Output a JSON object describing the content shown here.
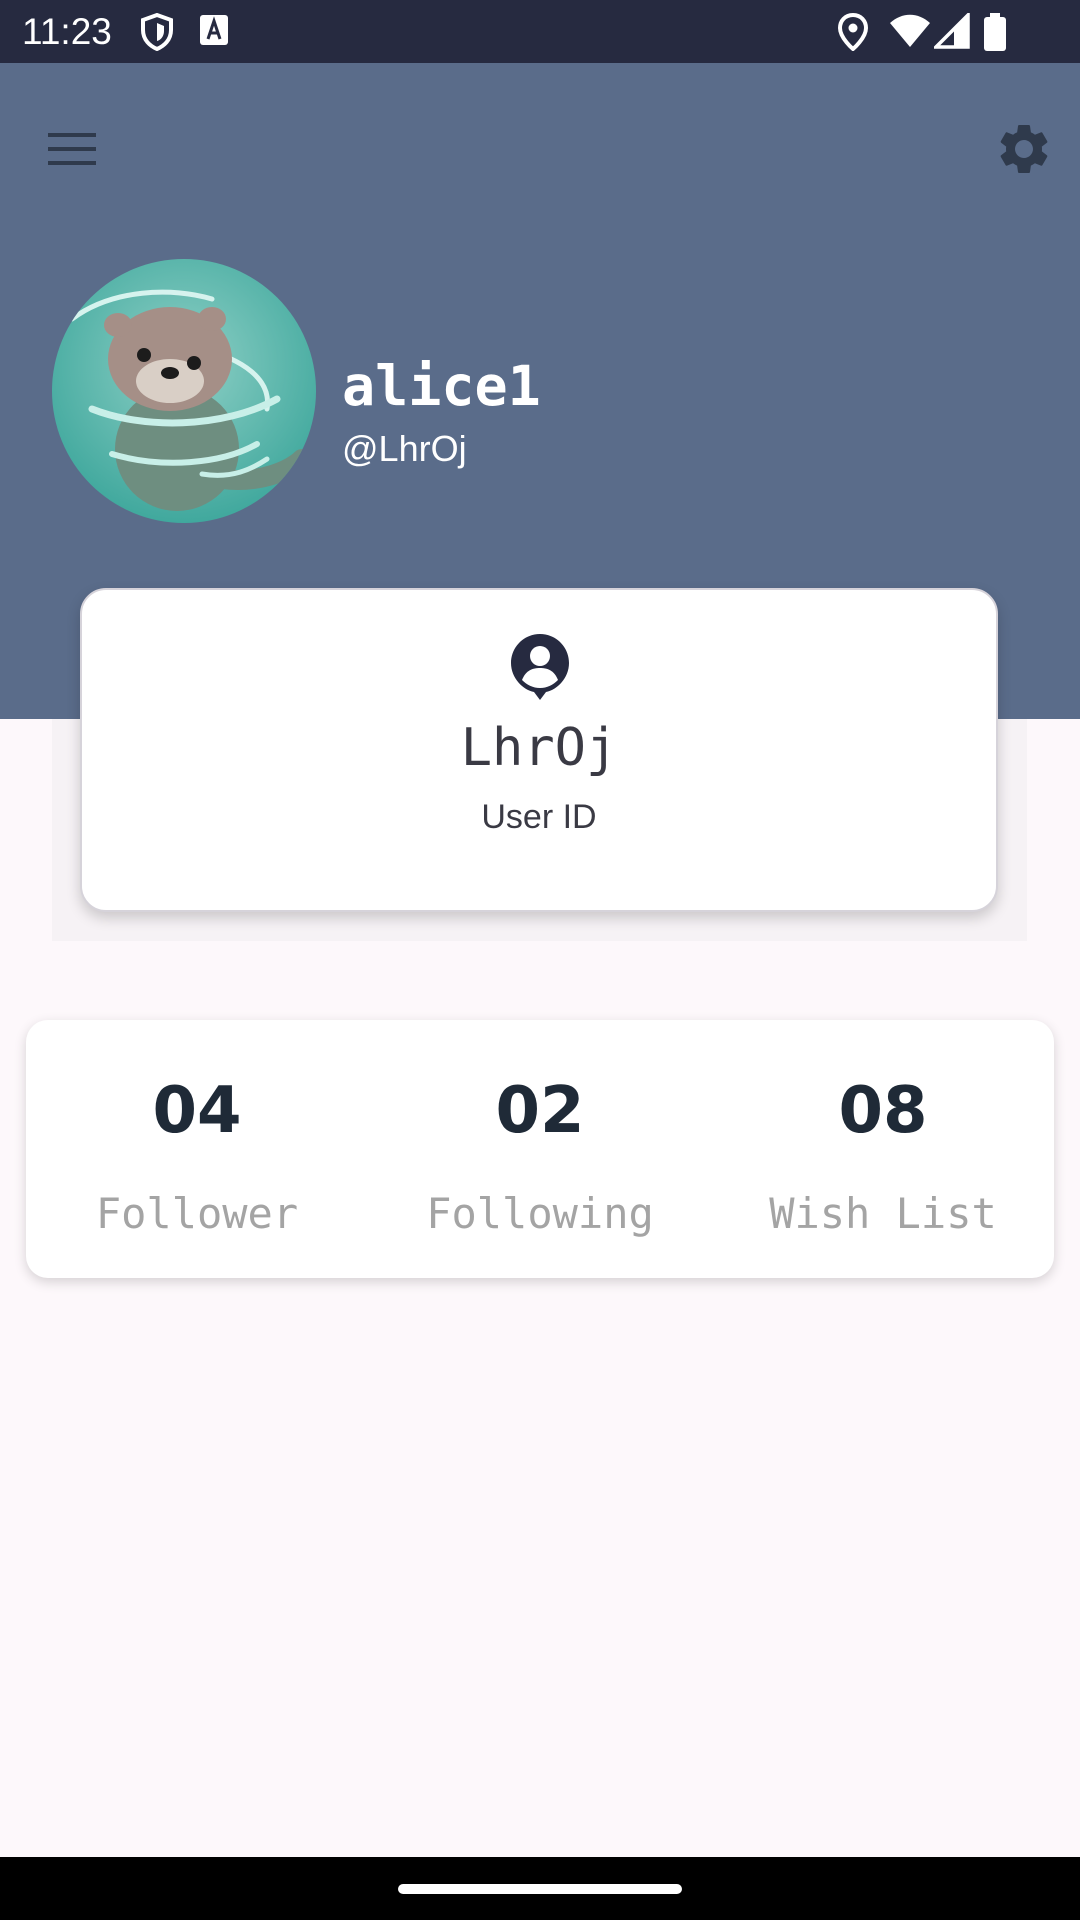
{
  "status_bar": {
    "time": "11:23",
    "icons": [
      "shield-icon",
      "font-a-icon",
      "location-icon",
      "wifi-icon",
      "signal-icon",
      "battery-icon"
    ]
  },
  "header": {
    "menu_icon": "menu-icon",
    "settings_icon": "gear-icon",
    "background_color": "#5a6c8a"
  },
  "profile": {
    "name": "alice1",
    "handle": "@LhrOj",
    "avatar": "otter-avatar"
  },
  "id_card": {
    "icon": "account-pin-icon",
    "value": "LhrOj",
    "label": "User ID"
  },
  "stats": [
    {
      "count": "04",
      "label": "Follower"
    },
    {
      "count": "02",
      "label": "Following"
    },
    {
      "count": "08",
      "label": "Wish List"
    }
  ],
  "colors": {
    "header_bg": "#5a6c8a",
    "status_bar_bg": "#262a40",
    "page_bg": "#fdf8fb",
    "stat_count": "#1f2a37",
    "stat_label": "#a4a4a4"
  }
}
